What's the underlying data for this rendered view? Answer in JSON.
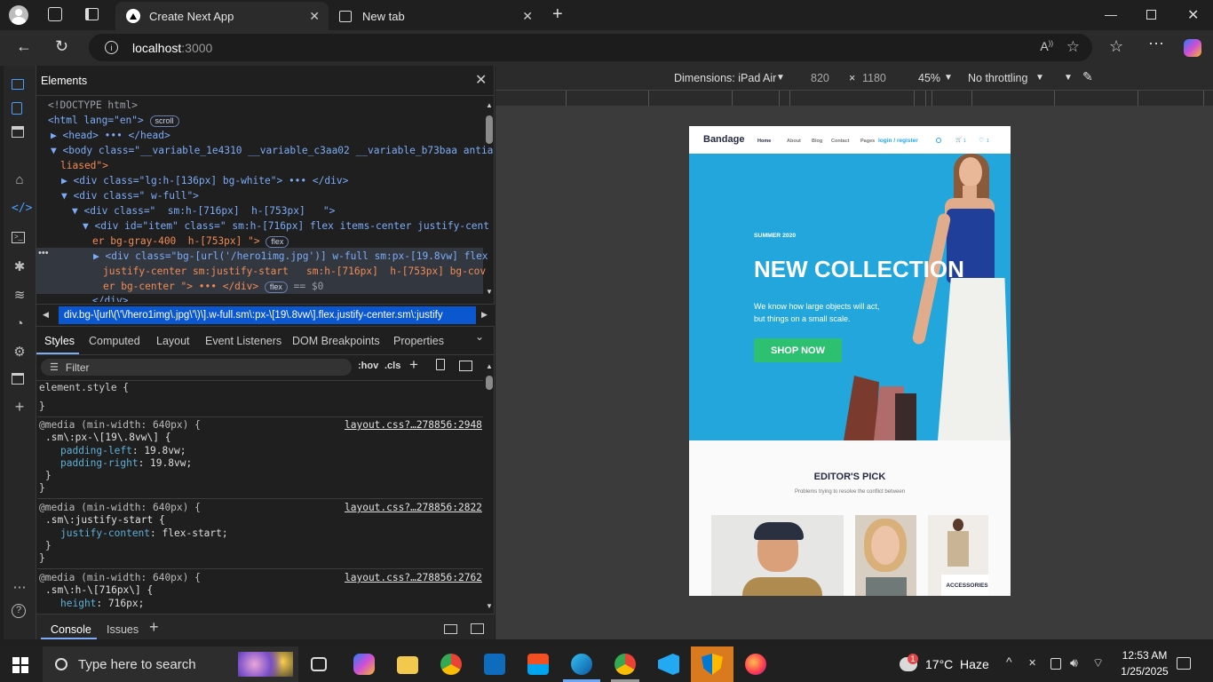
{
  "browser": {
    "tabs": [
      {
        "title": "Create Next App",
        "active": true
      },
      {
        "title": "New tab",
        "active": false
      }
    ],
    "url_host": "localhost",
    "url_port": ":3000"
  },
  "devtools": {
    "panel_title": "Elements",
    "dom_lines": [
      {
        "indent": 0,
        "html": "<!DOCTYPE html>"
      },
      {
        "indent": 0,
        "html": "<html lang=\"en\">",
        "badge": "scroll"
      },
      {
        "indent": 1,
        "html": "▶ <head> ••• </head>"
      },
      {
        "indent": 1,
        "html": "▼ <body class=\"__variable_1e4310 __variable_c3aa02 __variable_b73baa antia"
      },
      {
        "indent": 2,
        "html": "liased\">"
      },
      {
        "indent": 2,
        "html": "▶ <div class=\"lg:h-[136px] bg-white\"> ••• </div>"
      },
      {
        "indent": 2,
        "html": "▼ <div class=\" w-full\">"
      },
      {
        "indent": 3,
        "html": "▼ <div class=\"  sm:h-[716px]  h-[753px]   \">"
      },
      {
        "indent": 4,
        "html": "▼ <div id=\"item\" class=\" sm:h-[716px] flex items-center justify-cent"
      },
      {
        "indent": 5,
        "html": "er bg-gray-400  h-[753px] \">",
        "badge": "flex"
      },
      {
        "indent": 5,
        "html": "▶ <div class=\"bg-[url('/hero1img.jpg')] w-full sm:px-[19.8vw] flex"
      },
      {
        "indent": 6,
        "html": "justify-center sm:justify-start   sm:h-[716px]  h-[753px] bg-cov"
      },
      {
        "indent": 6,
        "html": "er bg-center \"> ••• </div>",
        "badge": "flex",
        "suffix": "== $0"
      },
      {
        "indent": 5,
        "html": "</div>"
      }
    ],
    "breadcrumb": "div.bg-\\[url\\(\\'\\/hero1img\\.jpg\\'\\)\\].w-full.sm\\:px-\\[19\\.8vw\\].flex.justify-center.sm\\:justify",
    "style_tabs": [
      "Styles",
      "Computed",
      "Layout",
      "Event Listeners",
      "DOM Breakpoints",
      "Properties"
    ],
    "filter_placeholder": "Filter",
    "hov": ":hov",
    "cls": ".cls",
    "element_style": "element.style {",
    "close_brace": "}",
    "rules": [
      {
        "media": "@media (min-width: 640px) {",
        "source": "layout.css?…278856:2948",
        "selector": ".sm\\:px-\\[19\\.8vw\\] {",
        "props": [
          [
            "padding-left",
            "19.8vw;"
          ],
          [
            "padding-right",
            "19.8vw;"
          ]
        ]
      },
      {
        "media": "@media (min-width: 640px) {",
        "source": "layout.css?…278856:2822",
        "selector": ".sm\\:justify-start {",
        "props": [
          [
            "justify-content",
            "flex-start;"
          ]
        ]
      },
      {
        "media": "@media (min-width: 640px) {",
        "source": "layout.css?…278856:2762",
        "selector": ".sm\\:h-\\[716px\\] {",
        "props": [
          [
            "height",
            "716px;"
          ]
        ]
      }
    ],
    "drawer_tabs": [
      "Console",
      "Issues"
    ]
  },
  "device_toolbar": {
    "dimensions": "Dimensions: iPad Air",
    "width": "820",
    "x": "×",
    "height": "1180",
    "zoom": "45%",
    "throttling": "No throttling"
  },
  "site": {
    "brand": "Bandage",
    "nav": [
      "Home",
      "About",
      "Blog",
      "Contact",
      "Pages"
    ],
    "login": "login / register",
    "cart_count": "1",
    "wish_count": "1",
    "season": "SUMMER 2020",
    "headline": "NEW COLLECTION",
    "sub1": "We know how large objects will act,",
    "sub2": "but things on a small scale.",
    "cta": "SHOP NOW",
    "editors_title": "EDITOR'S PICK",
    "editors_sub": "Problems trying to resolve the conflict between",
    "accessories": "ACCESSORIES"
  },
  "taskbar": {
    "search_placeholder": "Type here to search",
    "weather": "17°C  Haze",
    "weather_badge": "1",
    "time": "12:53 AM",
    "date": "1/25/2025"
  },
  "colors": {
    "hero": "#23a6db",
    "cta": "#2dc071",
    "link": "#23a6f0"
  }
}
